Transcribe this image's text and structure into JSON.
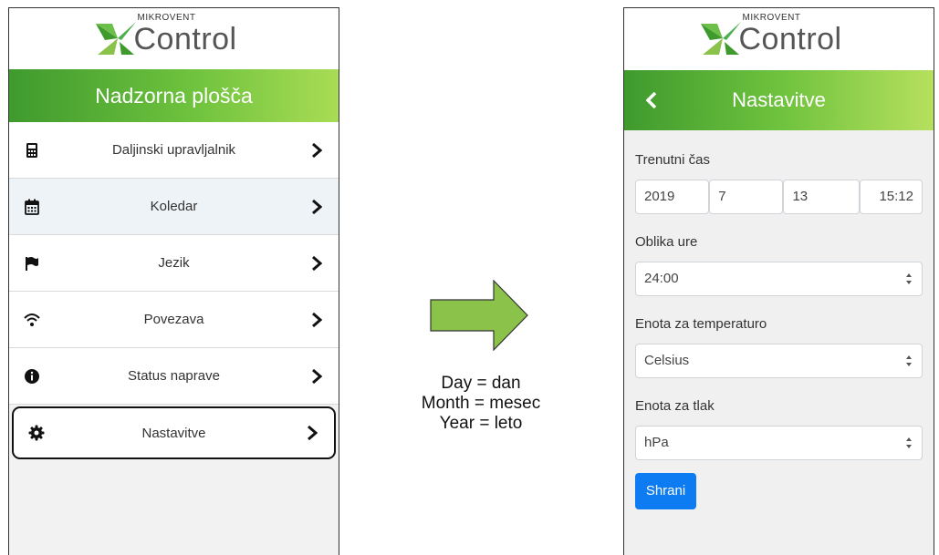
{
  "left_screen": {
    "brand": {
      "small": "MIKROVENT",
      "large": "Control"
    },
    "title": "Nadzorna plošča",
    "menu": [
      {
        "label": "Daljinski upravljalnik",
        "icon": "calculator-icon"
      },
      {
        "label": "Koledar",
        "icon": "calendar-icon"
      },
      {
        "label": "Jezik",
        "icon": "flag-icon"
      },
      {
        "label": "Povezava",
        "icon": "wifi-icon"
      },
      {
        "label": "Status naprave",
        "icon": "info-icon"
      },
      {
        "label": "Nastavitve",
        "icon": "gear-icon",
        "selected": true
      }
    ]
  },
  "legend": {
    "line1": "Day = dan",
    "line2": "Month = mesec",
    "line3": "Year = leto"
  },
  "right_screen": {
    "brand": {
      "small": "MIKROVENT",
      "large": "Control"
    },
    "title": "Nastavitve",
    "current_time": {
      "label": "Trenutni čas",
      "year": "2019",
      "month": "7",
      "day": "13",
      "time": "15:12"
    },
    "clock_format": {
      "label": "Oblika ure",
      "value": "24:00"
    },
    "temperature_unit": {
      "label": "Enota za temperaturo",
      "value": "Celsius"
    },
    "pressure_unit": {
      "label": "Enota za tlak",
      "value": "hPa"
    },
    "save_label": "Shrani"
  },
  "colors": {
    "green_dark": "#3f9a2e",
    "green_light": "#a9dc55",
    "arrow_fill": "#8bc34a",
    "save_blue": "#0d7bf2"
  }
}
